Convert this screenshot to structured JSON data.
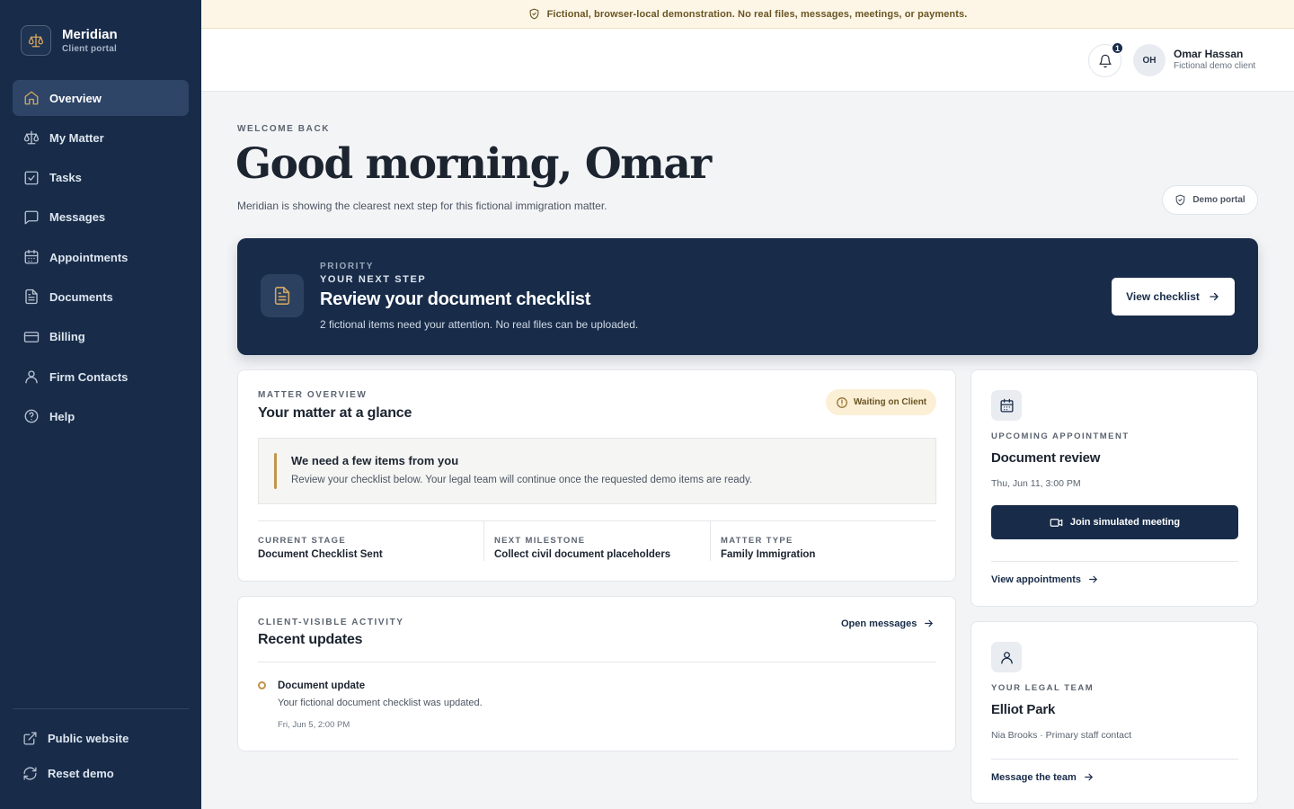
{
  "banner": {
    "text": "Fictional, browser-local demonstration. No real files, messages, meetings, or payments."
  },
  "brand": {
    "name": "Meridian",
    "subtitle": "Client portal"
  },
  "sidebar": {
    "items": [
      {
        "label": "Overview",
        "icon": "home-icon",
        "active": true
      },
      {
        "label": "My Matter",
        "icon": "scales-icon",
        "active": false
      },
      {
        "label": "Tasks",
        "icon": "checkbox-icon",
        "active": false
      },
      {
        "label": "Messages",
        "icon": "message-icon",
        "active": false
      },
      {
        "label": "Appointments",
        "icon": "calendar-icon",
        "active": false
      },
      {
        "label": "Documents",
        "icon": "document-icon",
        "active": false
      },
      {
        "label": "Billing",
        "icon": "credit-card-icon",
        "active": false
      },
      {
        "label": "Firm Contacts",
        "icon": "user-icon",
        "active": false
      },
      {
        "label": "Help",
        "icon": "help-circle-icon",
        "active": false
      }
    ],
    "bottom": [
      {
        "label": "Public website",
        "icon": "external-link-icon"
      },
      {
        "label": "Reset demo",
        "icon": "refresh-icon"
      }
    ]
  },
  "header": {
    "notification_count": "1",
    "avatar_initials": "OH",
    "user_name": "Omar Hassan",
    "user_subtitle": "Fictional demo client"
  },
  "welcome": {
    "eyebrow": "WELCOME BACK",
    "title": "Good morning, Omar",
    "subtitle": "Meridian is showing the clearest next step for this fictional immigration matter.",
    "demo_badge": "Demo portal"
  },
  "priority": {
    "eyebrow": "PRIORITY",
    "step_label": "YOUR NEXT STEP",
    "title": "Review your document checklist",
    "description": "2 fictional items need your attention. No real files can be uploaded.",
    "button_label": "View checklist"
  },
  "matter": {
    "eyebrow": "MATTER OVERVIEW",
    "title": "Your matter at a glance",
    "status": "Waiting on Client",
    "notice_title": "We need a few items from you",
    "notice_text": "Review your checklist below. Your legal team will continue once the requested demo items are ready.",
    "stats": [
      {
        "label": "CURRENT STAGE",
        "value": "Document Checklist Sent"
      },
      {
        "label": "NEXT MILESTONE",
        "value": "Collect civil document placeholders"
      },
      {
        "label": "MATTER TYPE",
        "value": "Family Immigration"
      }
    ]
  },
  "activity": {
    "eyebrow": "CLIENT-VISIBLE ACTIVITY",
    "title": "Recent updates",
    "link_label": "Open messages",
    "items": [
      {
        "title": "Document update",
        "text": "Your fictional document checklist was updated.",
        "time": "Fri, Jun 5, 2:00 PM"
      }
    ]
  },
  "appointment": {
    "eyebrow": "UPCOMING APPOINTMENT",
    "title": "Document review",
    "datetime": "Thu, Jun 11, 3:00 PM",
    "button_label": "Join simulated meeting",
    "link_label": "View appointments"
  },
  "team": {
    "eyebrow": "YOUR LEGAL TEAM",
    "name": "Elliot Park",
    "subtitle": "Nia Brooks · Primary staff contact",
    "link_label": "Message the team"
  },
  "colors": {
    "sidebar": "#182c49",
    "accent_gold": "#c0944a",
    "banner_bg": "#fdf6e6",
    "status_bg": "#fbefd6"
  }
}
